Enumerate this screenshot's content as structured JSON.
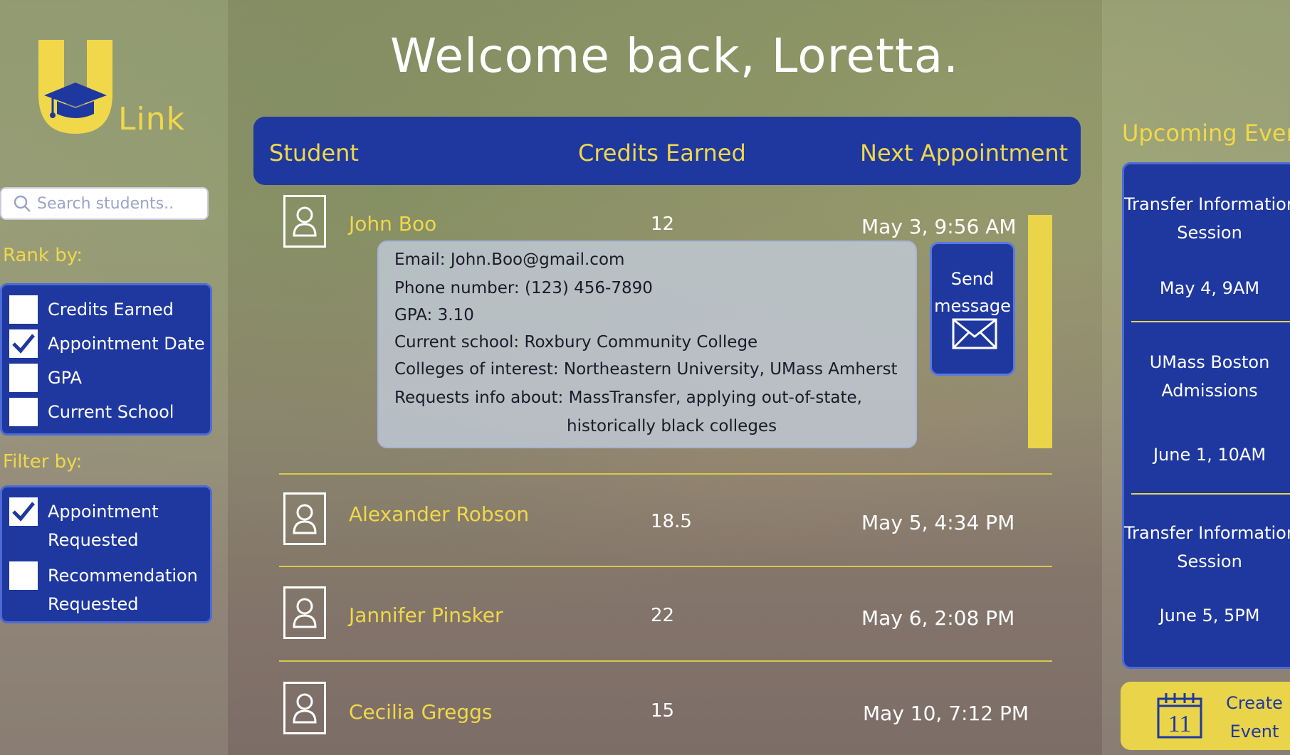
{
  "welcome": "Welcome  back, Loretta.",
  "logo": {
    "text": "Link"
  },
  "search": {
    "placeholder": "Search students.."
  },
  "rank": {
    "label": "Rank by:",
    "options": [
      {
        "label": "Credits Earned",
        "checked": false
      },
      {
        "label": "Appointment Date",
        "checked": true
      },
      {
        "label": "GPA",
        "checked": false
      },
      {
        "label": "Current School",
        "checked": false
      }
    ]
  },
  "filter": {
    "label": "Filter by:",
    "options": [
      {
        "label": "Appointment Requested",
        "checked": true
      },
      {
        "label": "Recommendation Requested",
        "checked": false
      }
    ]
  },
  "table": {
    "headers": [
      "Student",
      "Credits Earned",
      "Next Appointment"
    ],
    "rows": [
      {
        "name": "John Boo",
        "credits": "12",
        "appointment": "May 3, 9:56 AM"
      },
      {
        "name": "Alexander Robson",
        "credits": "18.5",
        "appointment": "May 5, 4:34 PM"
      },
      {
        "name": "Jannifer Pinsker",
        "credits": "22",
        "appointment": "May 6, 2:08 PM"
      },
      {
        "name": "Cecilia Greggs",
        "credits": "15",
        "appointment": "May 10, 7:12 PM"
      }
    ]
  },
  "details": {
    "email": "Email: John.Boo@gmail.com",
    "phone": "Phone number: (123) 456-7890",
    "gpa": "GPA: 3.10",
    "school": "Current school: Roxbury Community College",
    "interest": "Colleges of interest: Northeastern University, UMass Amherst",
    "requests": "Requests info about: MassTransfer, applying out-of-state,",
    "requests_cont": "historically black colleges"
  },
  "send_button": {
    "line1": "Send",
    "line2": "message"
  },
  "events": {
    "title": "Upcoming Events",
    "items": [
      {
        "line1": "Transfer Information",
        "line2": "Session",
        "date": "May 4, 9AM"
      },
      {
        "line1": "UMass Boston",
        "line2": "Admissions",
        "date": "June 1, 10AM"
      },
      {
        "line1": "Transfer Information",
        "line2": "Session",
        "date": "June 5, 5PM"
      }
    ]
  },
  "create_event": {
    "line1": "Create",
    "line2": "Event",
    "calendar_day": "11"
  },
  "colors": {
    "brand_blue": "#1f38a0",
    "brand_yellow": "#f0d84a"
  }
}
